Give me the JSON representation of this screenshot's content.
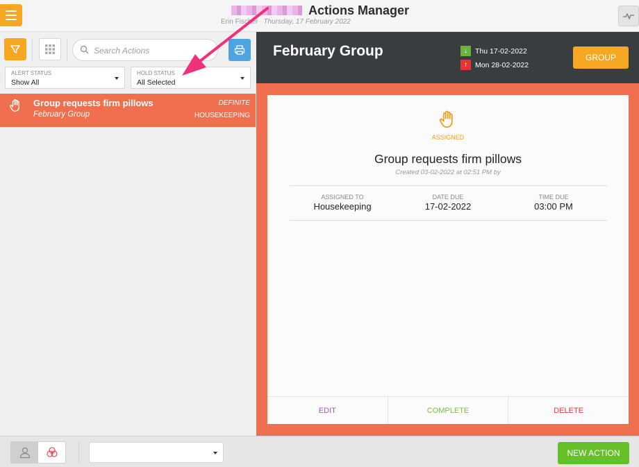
{
  "header": {
    "title": "Actions Manager",
    "user_name": "Erin Fischer",
    "date": "Thursday, 17 February 2022"
  },
  "search": {
    "placeholder": "Search Actions"
  },
  "filters": {
    "alert_status": {
      "label": "ALERT STATUS",
      "value": "Show All"
    },
    "hold_status": {
      "label": "HOLD STATUS",
      "value": "All Selected"
    }
  },
  "action_list": [
    {
      "title": "Group requests firm pillows",
      "group": "February Group",
      "status": "DEFINITE",
      "department": "HOUSEKEEPING"
    }
  ],
  "detail_header": {
    "group_title": "February Group",
    "arrival": "Thu 17-02-2022",
    "departure": "Mon 28-02-2022",
    "group_button": "GROUP"
  },
  "detail": {
    "status": "ASSIGNED",
    "title": "Group requests firm pillows",
    "created": "Created 03-02-2022 at 02:51 PM by",
    "assigned_to_label": "ASSIGNED TO",
    "assigned_to": "Housekeeping",
    "date_due_label": "DATE DUE",
    "date_due": "17-02-2022",
    "time_due_label": "TIME DUE",
    "time_due": "03:00 PM",
    "edit": "EDIT",
    "complete": "COMPLETE",
    "delete": "DELETE"
  },
  "footer": {
    "new_action": "NEW ACTION"
  },
  "colors": {
    "orange": "#f7a823",
    "coral": "#ef6f4f",
    "dark_header": "#3a3d40",
    "green": "#66c02a",
    "annotation_pink": "#f0307a"
  }
}
